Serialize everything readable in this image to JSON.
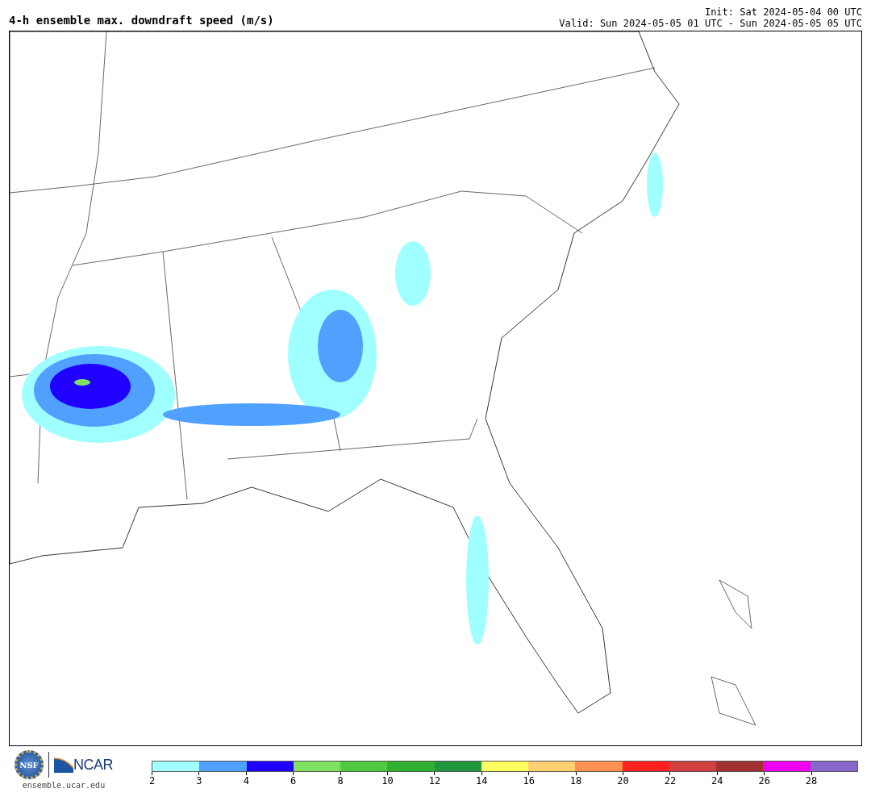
{
  "header": {
    "title": "4-h ensemble max. downdraft speed (m/s)",
    "init": "Init: Sat 2024-05-04 00 UTC",
    "valid": "Valid: Sun 2024-05-05 01 UTC - Sun 2024-05-05 05 UTC"
  },
  "footer": {
    "nsf_logo": "NSF",
    "ncar_logo": "NCAR",
    "site": "ensemble.ucar.edu"
  },
  "colorbar": {
    "segments": [
      {
        "color": "#a0ffff"
      },
      {
        "color": "#50a0ff"
      },
      {
        "color": "#2000ff"
      },
      {
        "color": "#80e060"
      },
      {
        "color": "#50c840"
      },
      {
        "color": "#30b030"
      },
      {
        "color": "#209840"
      },
      {
        "color": "#ffff60"
      },
      {
        "color": "#ffd070"
      },
      {
        "color": "#ff9050"
      },
      {
        "color": "#ff2020"
      },
      {
        "color": "#d04040"
      },
      {
        "color": "#a03030"
      },
      {
        "color": "#f000f0"
      },
      {
        "color": "#8868cc"
      }
    ],
    "ticks": [
      "2",
      "3",
      "4",
      "6",
      "8",
      "10",
      "12",
      "14",
      "16",
      "18",
      "20",
      "22",
      "24",
      "26",
      "28"
    ]
  }
}
